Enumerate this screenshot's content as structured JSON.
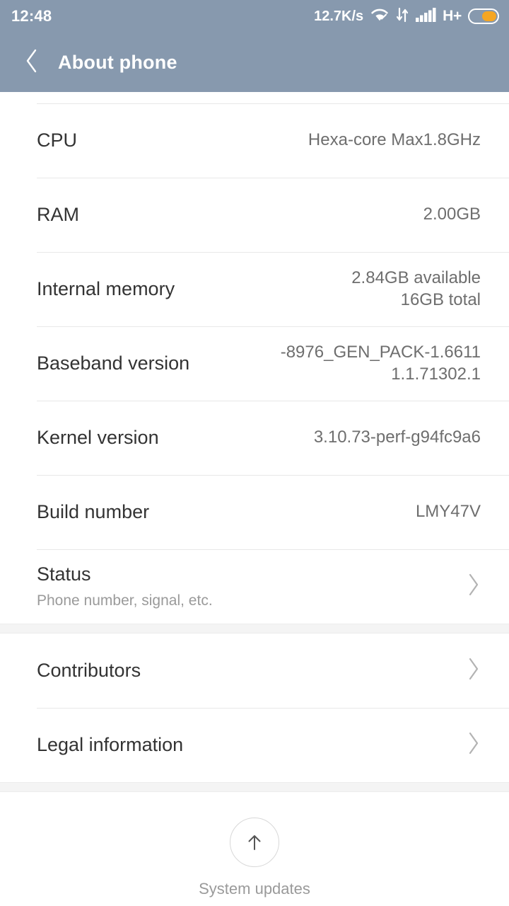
{
  "statusbar": {
    "time": "12:48",
    "network_speed": "12.7K/s",
    "wifi_icon": "wifi-icon",
    "data_transfer_icon": "data-transfer-arrows-icon",
    "signal_icon": "cellular-signal-icon",
    "network_type": "H+",
    "battery_icon": "battery-icon",
    "bg_color": "#8799ae",
    "battery_fill_color": "#f5a623"
  },
  "appbar": {
    "back_icon": "back-chevron-icon",
    "title": "About phone",
    "bg_color": "#8799ae"
  },
  "info_rows": [
    {
      "label": "CPU",
      "value": "Hexa-core Max1.8GHz"
    },
    {
      "label": "RAM",
      "value": "2.00GB"
    },
    {
      "label": "Internal memory",
      "value": "2.84GB available\n16GB total"
    },
    {
      "label": "Baseband version",
      "value": "-8976_GEN_PACK-1.6611\n1.1.71302.1"
    },
    {
      "label": "Kernel version",
      "value": "3.10.73-perf-g94fc9a6"
    },
    {
      "label": "Build number",
      "value": "LMY47V"
    }
  ],
  "status_row": {
    "label": "Status",
    "subtitle": "Phone number, signal, etc.",
    "chevron_icon": "chevron-right-icon"
  },
  "link_rows": [
    {
      "label": "Contributors",
      "chevron_icon": "chevron-right-icon"
    },
    {
      "label": "Legal information",
      "chevron_icon": "chevron-right-icon"
    }
  ],
  "footer": {
    "icon": "arrow-up-circle-icon",
    "label": "System updates"
  }
}
